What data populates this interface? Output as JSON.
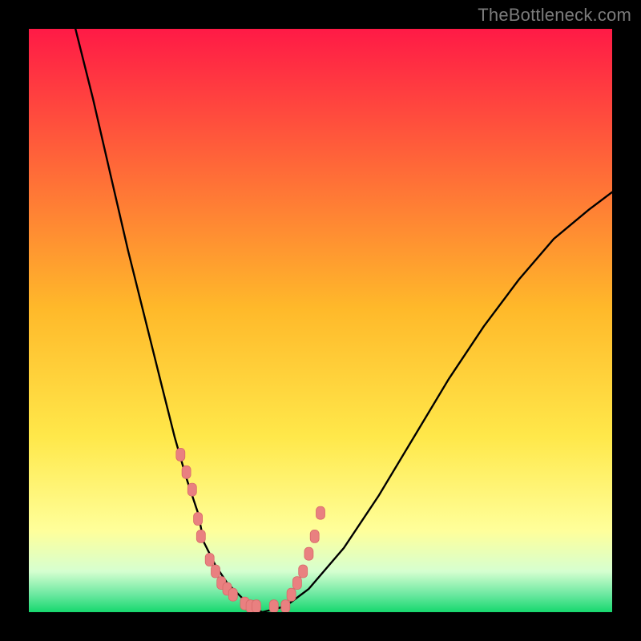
{
  "watermark": "TheBottleneck.com",
  "colors": {
    "gradient_top": "#ff1a46",
    "gradient_mid": "#ffd52a",
    "gradient_yellowwhite": "#ffff9a",
    "gradient_green": "#17d86e",
    "curve": "#000000",
    "marker_fill": "#e98080",
    "marker_stroke": "#d86a6a"
  },
  "chart_data": {
    "type": "line",
    "title": "",
    "xlabel": "",
    "ylabel": "",
    "xlim": [
      0,
      100
    ],
    "ylim": [
      0,
      100
    ],
    "grid": false,
    "legend": false,
    "annotations": [],
    "notes": "Bottleneck-style V curve. Axes are unlabeled; x/y values are approximate readings from the chart geometry on a 0–100 normalized scale where y=0 is the top and y=100 is the bottom of the plot area.",
    "series": [
      {
        "name": "bottleneck_curve",
        "x": [
          8,
          11,
          14,
          17,
          20,
          23,
          25,
          27,
          29,
          30,
          32,
          34,
          36,
          38,
          40,
          44,
          48,
          54,
          60,
          66,
          72,
          78,
          84,
          90,
          96,
          100
        ],
        "y": [
          0,
          12,
          25,
          38,
          50,
          62,
          70,
          77,
          83,
          88,
          92,
          95,
          97,
          99,
          100,
          99,
          96,
          89,
          80,
          70,
          60,
          51,
          43,
          36,
          31,
          28
        ]
      },
      {
        "name": "markers",
        "x": [
          26,
          27,
          28,
          29,
          29.5,
          31,
          32,
          33,
          34,
          35,
          37,
          38,
          39,
          42,
          44,
          45,
          46,
          47,
          48,
          49,
          50
        ],
        "y": [
          73,
          76,
          79,
          84,
          87,
          91,
          93,
          95,
          96,
          97,
          98.5,
          99,
          99,
          99,
          99,
          97,
          95,
          93,
          90,
          87,
          83
        ]
      }
    ]
  }
}
